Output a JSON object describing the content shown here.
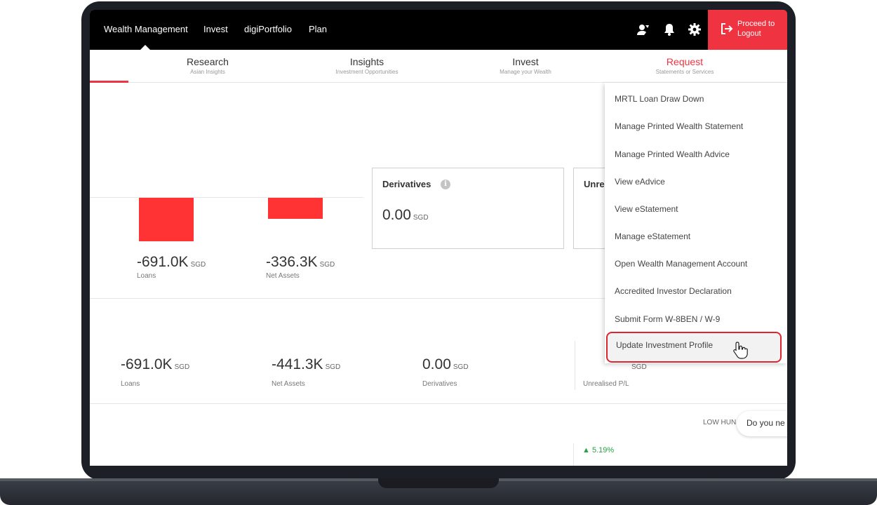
{
  "topnav": {
    "links": [
      "Wealth Management",
      "Invest",
      "digiPortfolio",
      "Plan"
    ],
    "logout_label_line1": "Proceed to",
    "logout_label_line2": "Logout"
  },
  "tabs": [
    {
      "title": "Research",
      "subtitle": "Asian Insights"
    },
    {
      "title": "Insights",
      "subtitle": "Investment Opportunities"
    },
    {
      "title": "Invest",
      "subtitle": "Manage your Wealth"
    },
    {
      "title": "Request",
      "subtitle": "Statements or Services"
    }
  ],
  "summary_top": {
    "loans_value": "-691.0K",
    "loans_unit": "SGD",
    "loans_label": "Loans",
    "net_assets_value": "-336.3K",
    "net_assets_unit": "SGD",
    "net_assets_label": "Net Assets"
  },
  "derivatives_card": {
    "title": "Derivatives",
    "info_symbol": "i",
    "value": "0.00",
    "unit": "SGD"
  },
  "unrealised_card": {
    "title_partial": "Unre"
  },
  "summary_mid": {
    "loans_value": "-691.0K",
    "loans_unit": "SGD",
    "loans_label": "Loans",
    "net_assets_value": "-441.3K",
    "net_assets_unit": "SGD",
    "net_assets_label": "Net Assets",
    "derivatives_value": "0.00",
    "derivatives_unit": "SGD",
    "derivatives_label": "Derivatives",
    "unrealised_unit": "SGD",
    "unrealised_label": "Unrealised P/L"
  },
  "bottom": {
    "low_hun": "LOW HUN",
    "chip_text": "Do you ne",
    "pct_change": "5.19%",
    "pct_arrow": "▲"
  },
  "dropdown": {
    "items": [
      "MRTL Loan Draw Down",
      "Manage Printed Wealth Statement",
      "Manage Printed Wealth Advice",
      "View eAdvice",
      "View eStatement",
      "Manage eStatement",
      "Open Wealth Management Account",
      "Accredited Investor Declaration",
      "Submit Form W-8BEN / W-9",
      "Update Investment Profile"
    ]
  },
  "colors": {
    "brand_red": "#ef3340",
    "bar_red": "#ff3333",
    "highlight_border": "#e0242f",
    "positive_green": "#26a344"
  }
}
